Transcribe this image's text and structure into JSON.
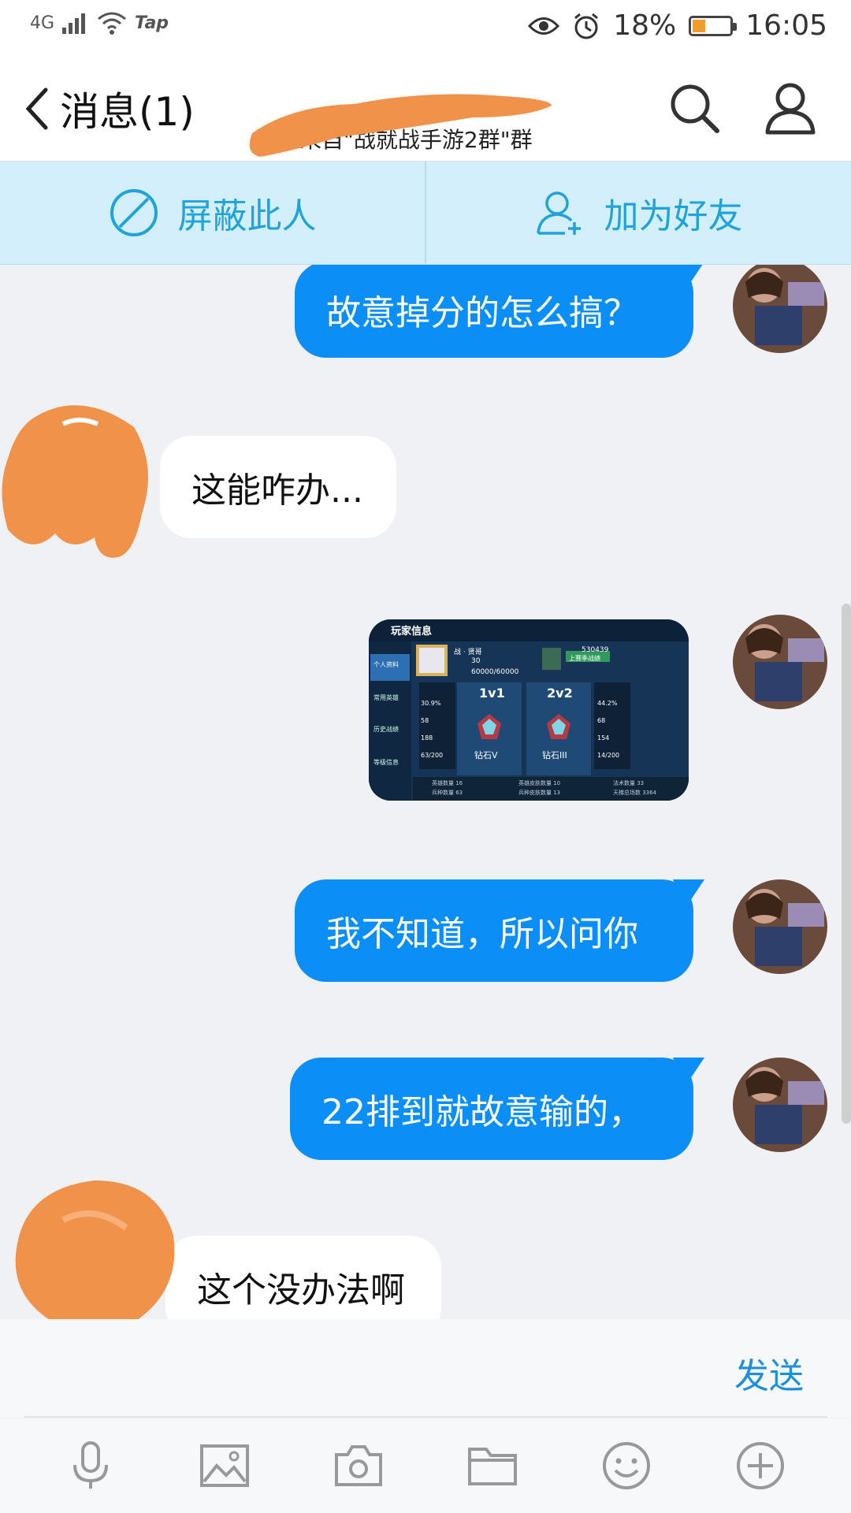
{
  "statusbar": {
    "network": "4G",
    "carrier": "Tap",
    "battery_percent": "18%",
    "time": "16:05"
  },
  "navbar": {
    "title": "消息(1)",
    "subtitle": "来自\"战就战手游2群\"群"
  },
  "actions": {
    "block_label": "屏蔽此人",
    "add_friend_label": "加为好友"
  },
  "messages": [
    {
      "side": "me",
      "text": "故意掉分的怎么搞？"
    },
    {
      "side": "them",
      "text": "这能咋办..."
    },
    {
      "side": "me",
      "type": "image"
    },
    {
      "side": "me",
      "text": "我不知道，所以问你"
    },
    {
      "side": "me",
      "text": "22排到就故意输的，"
    },
    {
      "side": "them",
      "text": "这个没办法啊"
    }
  ],
  "game_card": {
    "header": "玩家信息",
    "menu": [
      "个人资料",
      "常用英雄",
      "历史战绩",
      "等级信息"
    ],
    "name": "战 · 贤哥",
    "level": "30",
    "exp": "60000/60000",
    "player_id": "530439",
    "season_button": "上赛季战绩",
    "mode_1v1": "1v1",
    "mode_2v2": "2v2",
    "rank_1v1": "钻石V",
    "rank_2v2": "钻石III",
    "left_stats": [
      "30.9%",
      "58",
      "188",
      "63/200"
    ],
    "right_stats": [
      "44.2%",
      "68",
      "154",
      "14/200"
    ],
    "bottom_left": [
      "英雄数量 16",
      "兵种数量 63"
    ],
    "bottom_mid": [
      "英雄皮肤数量 10",
      "兵种皮肤数量 13"
    ],
    "bottom_right": [
      "法术数量 33",
      "天梯总场数 3364"
    ]
  },
  "input": {
    "send_label": "发送"
  },
  "toolbar": {
    "icons": [
      "microphone-icon",
      "image-icon",
      "camera-icon",
      "folder-icon",
      "emoji-icon",
      "plus-icon"
    ]
  },
  "colors": {
    "accent": "#0b8ef6",
    "action_bar_bg": "#d3effb",
    "action_text": "#20a3d8",
    "redaction": "#f0924a"
  }
}
